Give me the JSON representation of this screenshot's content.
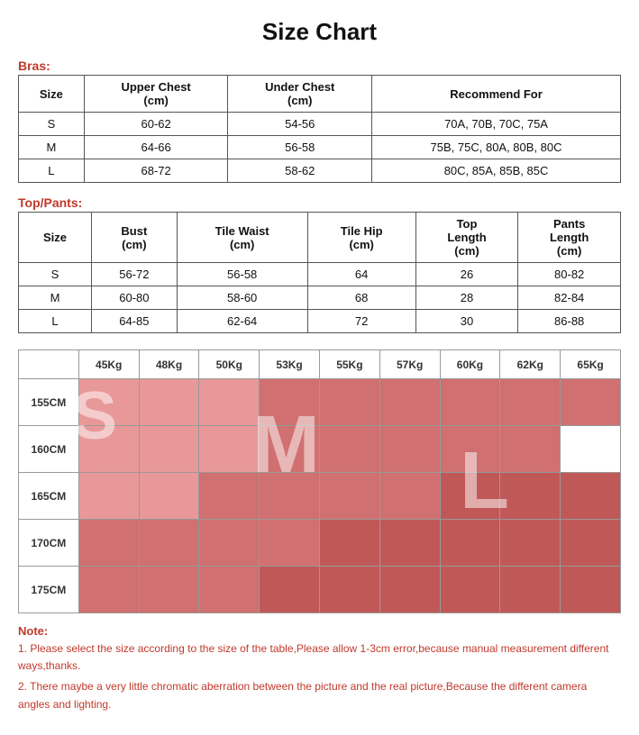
{
  "title": "Size Chart",
  "bras": {
    "label": "Bras:",
    "headers": [
      "Size",
      "Upper Chest\n(cm)",
      "Under Chest\n(cm)",
      "Recommend For"
    ],
    "rows": [
      [
        "S",
        "60-62",
        "54-56",
        "70A, 70B, 70C, 75A"
      ],
      [
        "M",
        "64-66",
        "56-58",
        "75B, 75C, 80A, 80B, 80C"
      ],
      [
        "L",
        "68-72",
        "58-62",
        "80C, 85A, 85B, 85C"
      ]
    ]
  },
  "topPants": {
    "label": "Top/Pants:",
    "headers": [
      "Size",
      "Bust\n(cm)",
      "Tile Waist\n(cm)",
      "Tile Hip\n(cm)",
      "Top Length\n(cm)",
      "Pants Length\n(cm)"
    ],
    "rows": [
      [
        "S",
        "56-72",
        "56-58",
        "64",
        "26",
        "80-82"
      ],
      [
        "M",
        "60-80",
        "58-60",
        "68",
        "28",
        "82-84"
      ],
      [
        "L",
        "64-85",
        "62-64",
        "72",
        "30",
        "86-88"
      ]
    ]
  },
  "weightHeightGrid": {
    "colHeaders": [
      "",
      "45Kg",
      "48Kg",
      "50Kg",
      "53Kg",
      "55Kg",
      "57Kg",
      "60Kg",
      "62Kg",
      "65Kg"
    ],
    "rows": [
      {
        "height": "155CM",
        "cells": [
          "s",
          "s",
          "s",
          "m",
          "m",
          "m",
          "m",
          "m",
          "m"
        ]
      },
      {
        "height": "160CM",
        "cells": [
          "s",
          "s",
          "s",
          "m",
          "m",
          "m",
          "m",
          "m",
          "white"
        ]
      },
      {
        "height": "165CM",
        "cells": [
          "s",
          "s",
          "m",
          "m",
          "m",
          "m",
          "l",
          "l",
          "l"
        ]
      },
      {
        "height": "170CM",
        "cells": [
          "m",
          "m",
          "m",
          "m",
          "l",
          "l",
          "l",
          "l",
          "l"
        ]
      },
      {
        "height": "175CM",
        "cells": [
          "m",
          "m",
          "m",
          "l",
          "l",
          "l",
          "l",
          "l",
          "l"
        ]
      }
    ],
    "sizeLetters": [
      "S",
      "M",
      "L"
    ]
  },
  "notes": {
    "title": "Note:",
    "lines": [
      "1. Please select the size according to the size of the table,Please allow 1-3cm error,because manual measurement different ways,thanks.",
      "2. There maybe a very little chromatic aberration between the picture and the real picture,Because the different camera angles and lighting."
    ]
  }
}
